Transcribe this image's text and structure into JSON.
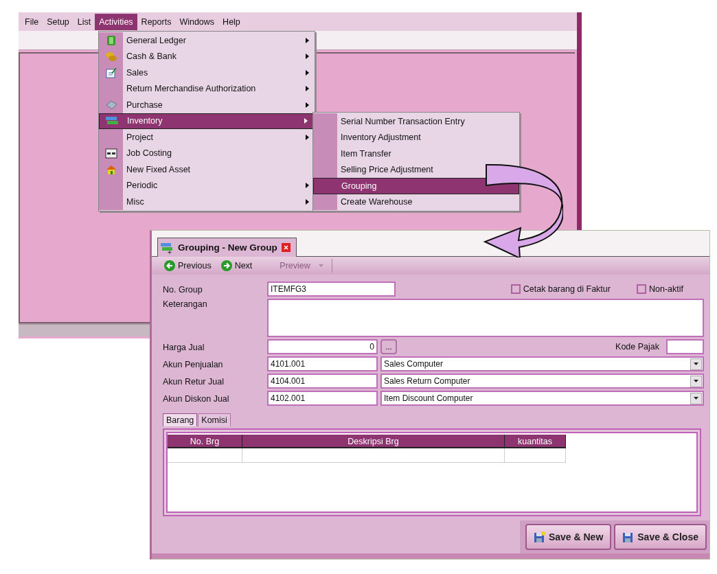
{
  "main_window": {
    "menu_bar": [
      {
        "label": "File",
        "selected": false
      },
      {
        "label": "Setup",
        "selected": false
      },
      {
        "label": "List",
        "selected": false
      },
      {
        "label": "Activities",
        "selected": true
      },
      {
        "label": "Reports",
        "selected": false
      },
      {
        "label": "Windows",
        "selected": false
      },
      {
        "label": "Help",
        "selected": false
      }
    ]
  },
  "activities_menu": [
    {
      "label": "General Ledger",
      "submenu": true,
      "selected": false
    },
    {
      "label": "Cash & Bank",
      "submenu": true,
      "selected": false
    },
    {
      "label": "Sales",
      "submenu": true,
      "selected": false
    },
    {
      "label": "Return Merchandise Authorization",
      "submenu": true,
      "selected": false
    },
    {
      "label": "Purchase",
      "submenu": true,
      "selected": false
    },
    {
      "label": "Inventory",
      "submenu": true,
      "selected": true
    },
    {
      "label": "Project",
      "submenu": true,
      "selected": false
    },
    {
      "label": "Job Costing",
      "submenu": false,
      "selected": false
    },
    {
      "label": "New Fixed Asset",
      "submenu": false,
      "selected": false
    },
    {
      "label": "Periodic",
      "submenu": true,
      "selected": false
    },
    {
      "label": "Misc",
      "submenu": true,
      "selected": false
    }
  ],
  "inventory_submenu": [
    {
      "label": "Serial Number Transaction Entry",
      "selected": false
    },
    {
      "label": "Inventory Adjustment",
      "selected": false
    },
    {
      "label": "Item Transfer",
      "selected": false
    },
    {
      "label": "Selling Price Adjustment",
      "selected": false
    },
    {
      "label": "Grouping",
      "selected": true
    },
    {
      "label": "Create Warehouse",
      "selected": false
    }
  ],
  "dialog": {
    "tab_title": "Grouping - New Group",
    "toolbar": [
      {
        "label": "Previous",
        "disabled": false
      },
      {
        "label": "Next",
        "disabled": false
      },
      {
        "label": "Preview",
        "disabled": true
      }
    ],
    "no_group": {
      "label": "No. Group",
      "value": "ITEMFG3"
    },
    "checkboxes": [
      {
        "label": "Cetak barang di Faktur",
        "checked": false
      },
      {
        "label": "Non-aktif",
        "checked": false
      }
    ],
    "keterangan": {
      "label": "Keterangan"
    },
    "harga_jual": {
      "label": "Harga Jual",
      "value": "0",
      "button": "..."
    },
    "kode_pajak": {
      "label": "Kode Pajak"
    },
    "accounts": [
      {
        "label": "Akun Penjualan",
        "code": "4101.001",
        "name": "Sales Computer"
      },
      {
        "label": "Akun Retur Jual",
        "code": "4104.001",
        "name": "Sales Return Computer"
      },
      {
        "label": "Akun Diskon Jual",
        "code": "4102.001",
        "name": "Item Discount Computer"
      }
    ],
    "tabs": [
      {
        "label": "Barang",
        "selected": true
      },
      {
        "label": "Komisi",
        "selected": false
      }
    ],
    "table": {
      "columns": [
        "No. Brg",
        "Deskripsi Brg",
        "kuantitas"
      ]
    },
    "buttons": [
      {
        "label": "Save & New"
      },
      {
        "label": "Save & Close"
      }
    ]
  }
}
